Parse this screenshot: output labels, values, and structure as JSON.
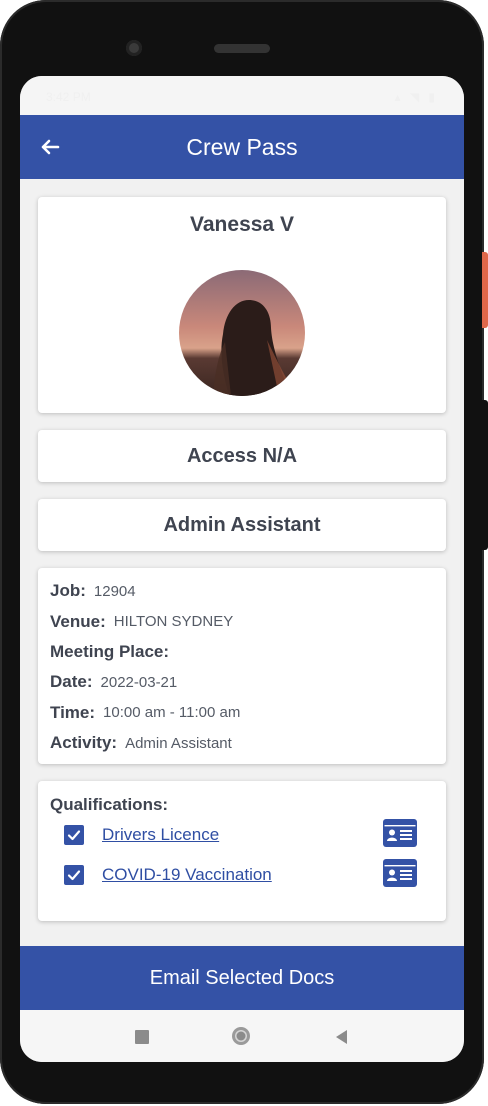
{
  "statusbar": {
    "time": "3:42 PM",
    "icons": "▴ ◥ ▮"
  },
  "appbar": {
    "title": "Crew Pass",
    "back_icon": "arrow-left-icon"
  },
  "profile": {
    "name": "Vanessa V"
  },
  "access": {
    "label": "Access N/A"
  },
  "role": {
    "label": "Admin Assistant"
  },
  "details": [
    {
      "label": "Job:",
      "value": "12904"
    },
    {
      "label": "Venue:",
      "value": "HILTON SYDNEY"
    },
    {
      "label": "Meeting Place:",
      "value": ""
    },
    {
      "label": "Date:",
      "value": "2022-03-21"
    },
    {
      "label": "Time:",
      "value": "10:00 am - 11:00 am"
    },
    {
      "label": "Activity:",
      "value": "Admin Assistant"
    }
  ],
  "qualifications": {
    "title": "Qualifications:",
    "items": [
      {
        "name": "Drivers Licence",
        "checked": true,
        "icon": "id-card-icon"
      },
      {
        "name": "COVID-19 Vaccination",
        "checked": true,
        "icon": "id-card-icon"
      }
    ]
  },
  "email_button": {
    "label": "Email Selected Docs"
  },
  "colors": {
    "primary": "#3452a6",
    "text": "#3f4450",
    "background": "#f1f1f1"
  }
}
